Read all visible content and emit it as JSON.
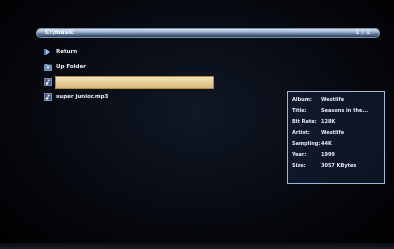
{
  "path_bar": {
    "path": "C:\\music",
    "page": "1 / 1"
  },
  "file_list": [
    {
      "label": "Return",
      "icon": "return-icon"
    },
    {
      "label": "Up Folder",
      "icon": "folder-up-icon"
    },
    {
      "label": "",
      "icon": "music-file-icon",
      "selected": true
    },
    {
      "label": "super junior.mp3",
      "icon": "music-file-icon"
    }
  ],
  "info_panel": {
    "rows": [
      {
        "key": "Album:",
        "value": "Westlife"
      },
      {
        "key": "Title:",
        "value": "Seasons in the..."
      },
      {
        "key": "Bit Rate:",
        "value": "128K"
      },
      {
        "key": "Artist:",
        "value": "Westlife"
      },
      {
        "key": "Sampling:",
        "value": "44K"
      },
      {
        "key": "Year:",
        "value": "1999"
      },
      {
        "key": "Size:",
        "value": "3057 KBytes"
      }
    ]
  },
  "colors": {
    "selection_fill": "#e6cf98",
    "panel_border": "#9fb6d8",
    "bar_highlight": "#e6eef8"
  }
}
